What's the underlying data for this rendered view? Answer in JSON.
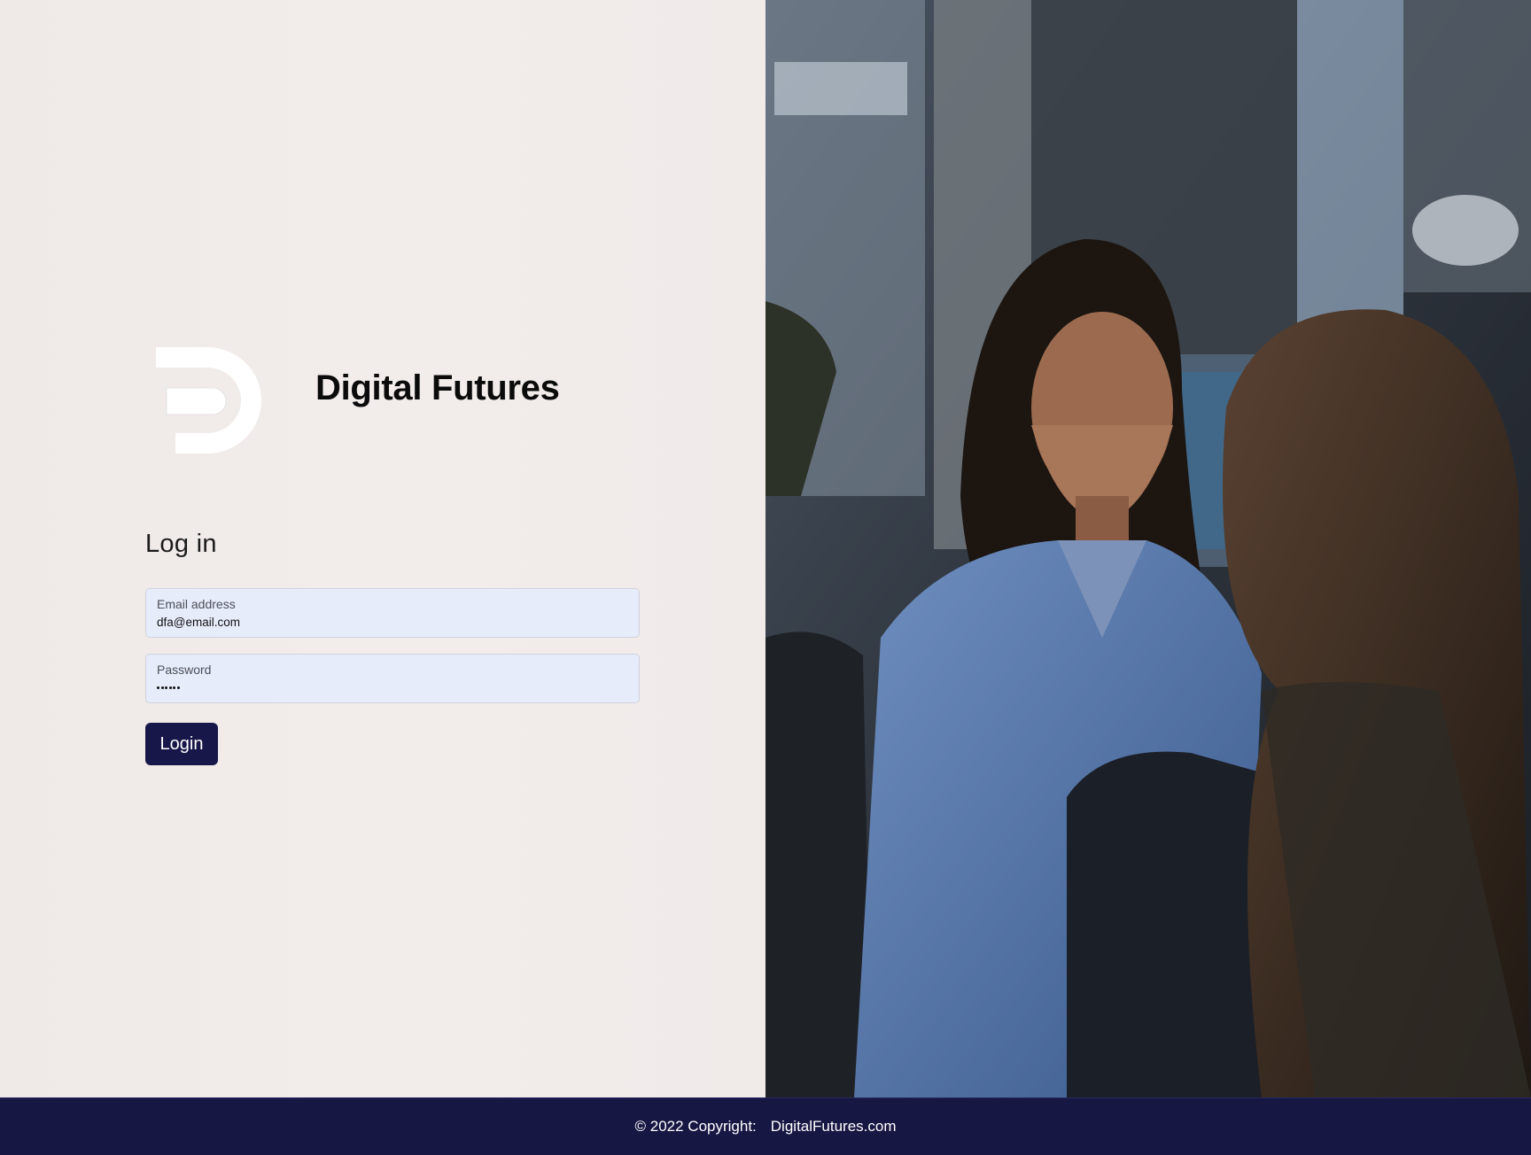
{
  "brand": {
    "name": "Digital Futures",
    "logo_icon": "digital-futures-d-logo"
  },
  "login": {
    "title": "Log in",
    "email": {
      "label": "Email address",
      "value": "dfa@email.com"
    },
    "password": {
      "label": "Password",
      "masked_length": 6
    },
    "submit_label": "Login"
  },
  "photo": {
    "icon": "office-photo"
  },
  "footer": {
    "copyright": "© 2022 Copyright:",
    "link": "DigitalFutures.com"
  },
  "colors": {
    "background": "#efeae8",
    "field_background": "#e7ecfb",
    "button": "#17174a",
    "footer": "#171744"
  }
}
